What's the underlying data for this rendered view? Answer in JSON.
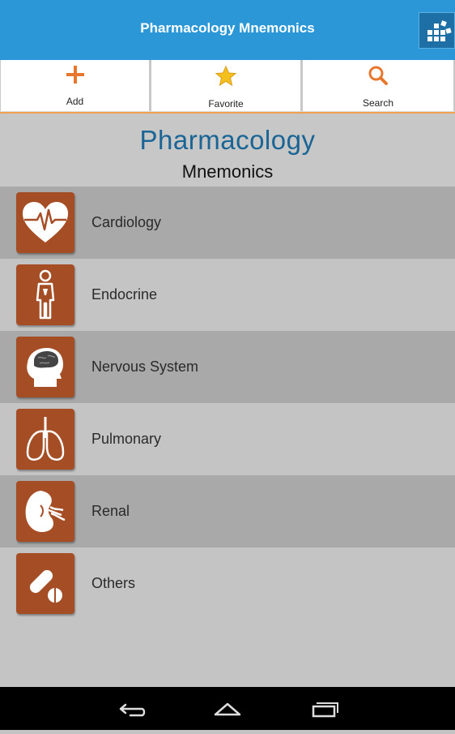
{
  "app": {
    "title": "Pharmacology Mnemonics"
  },
  "toolbar": {
    "add_label": "Add",
    "favorite_label": "Favorite",
    "search_label": "Search"
  },
  "hero": {
    "title": "Pharmacology",
    "subtitle": "Mnemonics"
  },
  "categories": [
    {
      "label": "Cardiology",
      "icon": "heart-ecg-icon"
    },
    {
      "label": "Endocrine",
      "icon": "body-organs-icon"
    },
    {
      "label": "Nervous System",
      "icon": "head-brain-icon"
    },
    {
      "label": "Pulmonary",
      "icon": "lungs-icon"
    },
    {
      "label": "Renal",
      "icon": "kidney-icon"
    },
    {
      "label": "Others",
      "icon": "pills-icon"
    }
  ],
  "colors": {
    "app_bar": "#2b97d6",
    "tile": "#a54e26",
    "accent_orange": "#e8772e",
    "title_blue": "#1a6595"
  }
}
